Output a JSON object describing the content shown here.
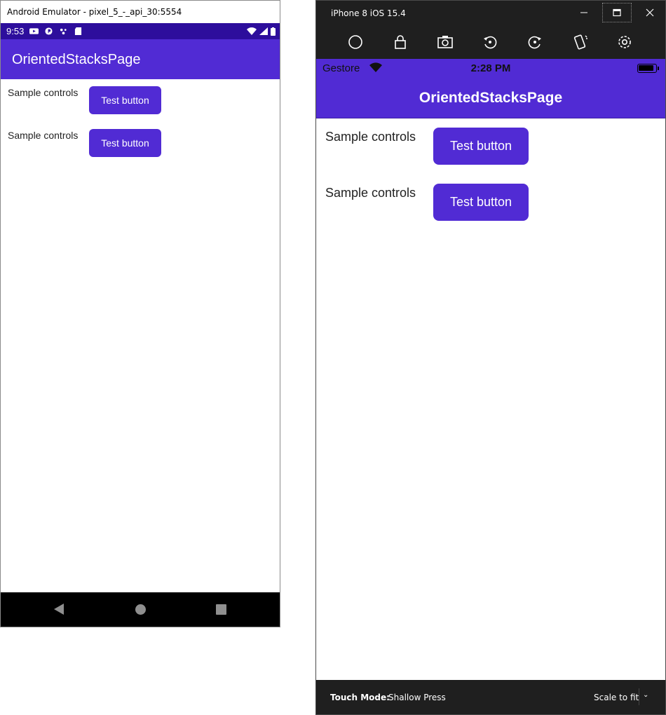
{
  "android": {
    "window_title": "Android Emulator - pixel_5_-_api_30:5554",
    "status_time": "9:53",
    "app_title": "OrientedStacksPage",
    "rows": [
      {
        "label": "Sample controls",
        "button": "Test button"
      },
      {
        "label": "Sample controls",
        "button": "Test button"
      }
    ],
    "nav_icons": [
      "back-icon",
      "home-icon",
      "recents-icon"
    ]
  },
  "ios": {
    "window_title": "iPhone 8 iOS 15.4",
    "toolbar_icons": [
      "home-icon",
      "lock-icon",
      "camera-icon",
      "rotate-left-icon",
      "rotate-right-icon",
      "shake-icon",
      "settings-icon"
    ],
    "carrier": "Gestore",
    "status_time": "2:28 PM",
    "app_title": "OrientedStacksPage",
    "rows": [
      {
        "label": "Sample controls",
        "button": "Test button"
      },
      {
        "label": "Sample controls",
        "button": "Test button"
      }
    ],
    "footer": {
      "touch_mode_label": "Touch Mode:",
      "touch_mode_value": "Shallow Press",
      "scale_value": "Scale to fit"
    }
  },
  "colors": {
    "accent": "#512bd4",
    "android_status_bar": "#2d0e9c",
    "simulator_chrome": "#1f1f1f"
  }
}
